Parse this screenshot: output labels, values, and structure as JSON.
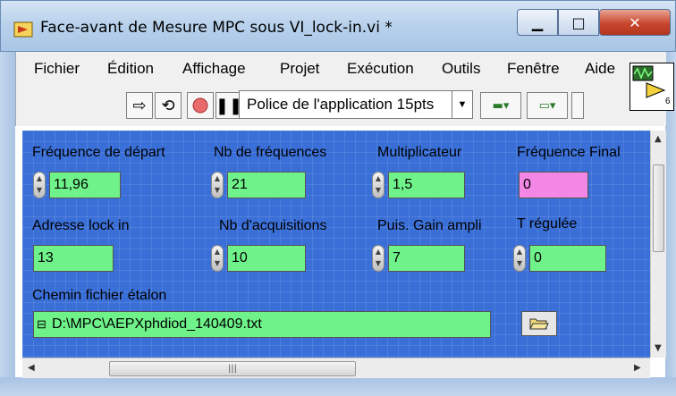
{
  "window": {
    "title": "Face-avant de Mesure MPC sous VI_lock-in.vi *"
  },
  "menu": [
    "Fichier",
    "Édition",
    "Affichage",
    "Projet",
    "Exécution",
    "Outils",
    "Fenêtre",
    "Aide"
  ],
  "toolbar": {
    "font_selector": "Police de l'application 15pts"
  },
  "controls": {
    "freq_start": {
      "label": "Fréquence de départ",
      "value": "11,96"
    },
    "nb_freq": {
      "label": "Nb de fréquences",
      "value": "21"
    },
    "multiplier": {
      "label": "Multiplicateur",
      "value": "1,5"
    },
    "freq_final": {
      "label": "Fréquence Final",
      "value": "0"
    },
    "lockin_addr": {
      "label": "Adresse lock in",
      "value": "13"
    },
    "nb_acq": {
      "label": "Nb d'acquisitions",
      "value": "10"
    },
    "gain": {
      "label": "Puis. Gain ampli",
      "value": "7"
    },
    "temp": {
      "label": "T régulée",
      "value": "0"
    },
    "calib_path": {
      "label": "Chemin fichier étalon",
      "value": "D:\\MPC\\AEPXphdiod_140409.txt"
    }
  },
  "vi_icon_number": "6",
  "colors": {
    "panel": "#3a6fd8",
    "numeric_control": "#6ff28a",
    "indicator": "#f287e6"
  }
}
